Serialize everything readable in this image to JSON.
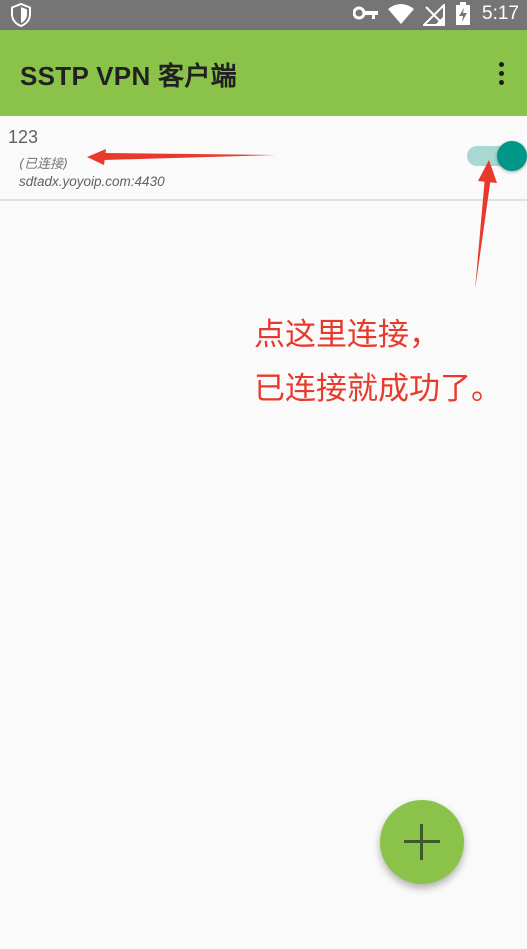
{
  "status_bar": {
    "time": "5:17",
    "icons": [
      "shield-icon",
      "vpn-key-icon",
      "wifi-icon",
      "no-signal-icon",
      "battery-charging-icon"
    ]
  },
  "app_bar": {
    "title": "SSTP VPN 客户端",
    "overflow_icon": "more-vert-icon",
    "color": "#8bc34a"
  },
  "profiles": [
    {
      "name": "123",
      "status": "(已连接)",
      "host": "sdtadx.yoyoip.com:4430",
      "connected": true
    }
  ],
  "annotation": {
    "line1": "点这里连接，",
    "line2": "已连接就成功了。",
    "color": "#e83a2c"
  },
  "fab": {
    "icon": "add-icon"
  },
  "colors": {
    "accent": "#009688",
    "track": "#a9d7d2"
  }
}
